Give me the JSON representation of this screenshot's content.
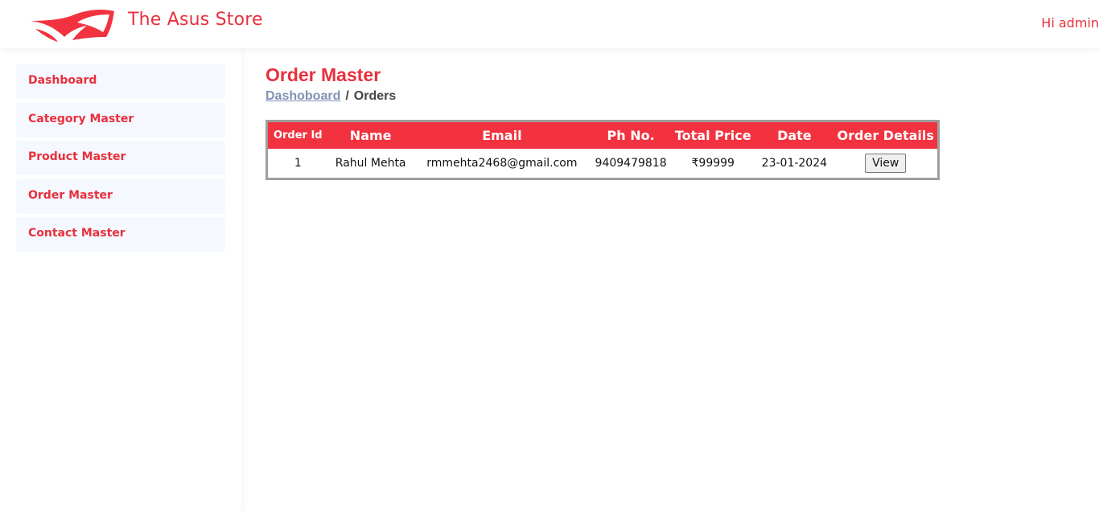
{
  "header": {
    "brand": "The Asus Store",
    "greeting": "Hi admin"
  },
  "sidebar": {
    "items": [
      {
        "label": "Dashboard"
      },
      {
        "label": "Category Master"
      },
      {
        "label": "Product Master"
      },
      {
        "label": "Order Master"
      },
      {
        "label": "Contact Master"
      }
    ]
  },
  "page": {
    "title": "Order Master",
    "breadcrumb": {
      "link": "Dashoboard",
      "separator": "/",
      "current": "Orders"
    }
  },
  "table": {
    "columns": [
      "Order Id",
      "Name",
      "Email",
      "Ph No.",
      "Total Price",
      "Date",
      "Order Details"
    ],
    "rows": [
      {
        "order_id": "1",
        "name": "Rahul Mehta",
        "email": "rmmehta2468@gmail.com",
        "phone": "9409479818",
        "total": "₹99999",
        "date": "23-01-2024",
        "action": "View"
      }
    ]
  },
  "colors": {
    "accent": "#e8303d",
    "table_header": "#f2333f",
    "sidebar_item_bg": "#f5f8fe",
    "breadcrumb_link": "#7f93b4"
  }
}
